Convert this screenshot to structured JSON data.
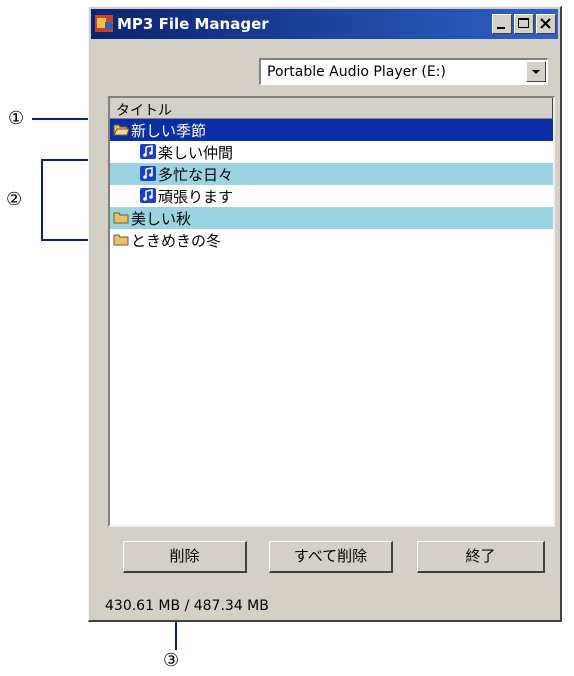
{
  "window": {
    "title": "MP3 File Manager",
    "controls": [
      "minimize-icon",
      "maximize-icon",
      "close-icon"
    ]
  },
  "device_dropdown": {
    "value": "Portable Audio Player (E:)"
  },
  "list": {
    "column_header": "タイトル",
    "rows": [
      {
        "type": "folder",
        "label": "新しい季節",
        "state": "selected"
      },
      {
        "type": "track",
        "label": "楽しい仲間",
        "state": "normal"
      },
      {
        "type": "track",
        "label": "多忙な日々",
        "state": "highlight"
      },
      {
        "type": "track",
        "label": "頑張ります",
        "state": "normal"
      },
      {
        "type": "folder",
        "label": "美しい秋",
        "state": "highlight"
      },
      {
        "type": "folder",
        "label": "ときめきの冬",
        "state": "normal"
      }
    ]
  },
  "buttons": {
    "delete": "削除",
    "delete_all": "すべて削除",
    "exit": "終了"
  },
  "status": {
    "usage": "430.61 MB / 487.34 MB"
  },
  "callouts": {
    "one": "①",
    "two": "②",
    "three": "③"
  },
  "colors": {
    "title_bar": "#0b2470",
    "selection": "#0b2ea8",
    "highlight_row": "#9ad4e0",
    "window_face": "#d4d0c8"
  }
}
